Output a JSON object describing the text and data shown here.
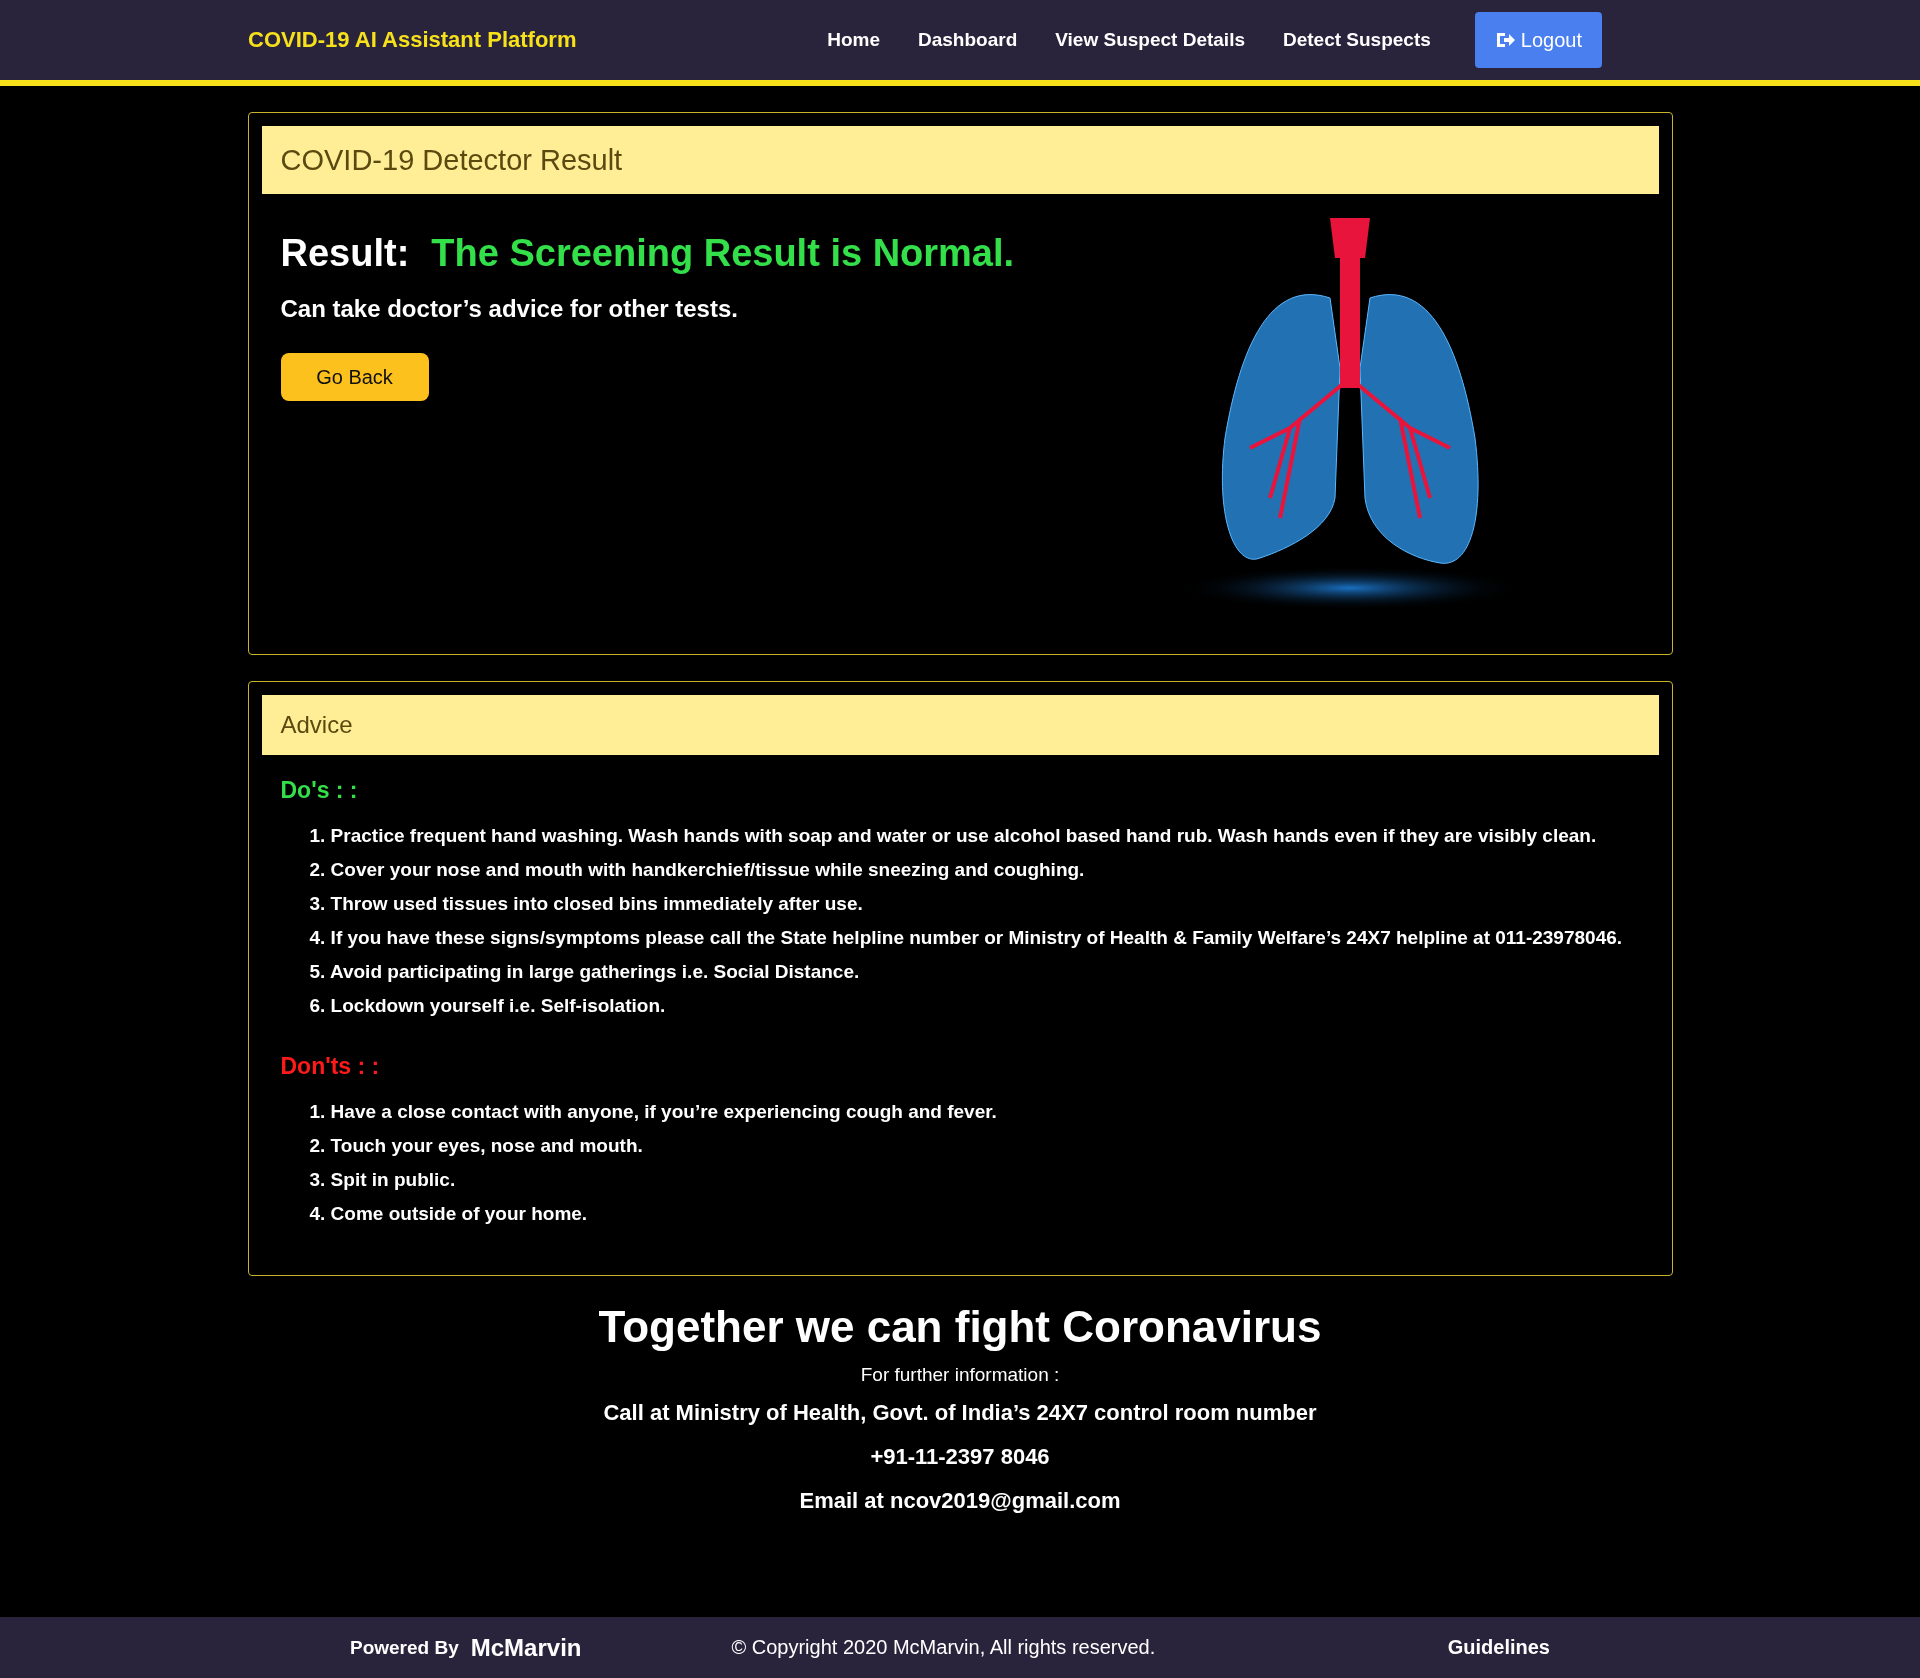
{
  "navbar": {
    "brand": "COVID-19 AI Assistant Platform",
    "links": [
      {
        "label": "Home"
      },
      {
        "label": "Dashboard"
      },
      {
        "label": "View Suspect Details"
      },
      {
        "label": "Detect Suspects"
      }
    ],
    "logout": "Logout"
  },
  "result_card": {
    "title": "COVID-19 Detector Result",
    "result_label": "Result:",
    "result_text": "The Screening Result is Normal.",
    "advice_text": "Can take doctor’s advice for other tests.",
    "button": "Go Back"
  },
  "advice_card": {
    "title": "Advice",
    "sections": [
      {
        "heading": "Do's : :",
        "kind": "do",
        "items": [
          "1. Practice frequent hand washing. Wash hands with soap and water or use alcohol based hand rub. Wash hands even if they are visibly clean.",
          "2. Cover your nose and mouth with handkerchief/tissue while sneezing and coughing.",
          "3. Throw used tissues into closed bins immediately after use.",
          "4. If you have these signs/symptoms please call the State helpline number or Ministry of Health & Family Welfare’s 24X7 helpline at 011-23978046.",
          "5. Avoid participating in large gatherings i.e. Social Distance.",
          "6. Lockdown yourself i.e. Self-isolation."
        ]
      },
      {
        "heading": "Don'ts : :",
        "kind": "dont",
        "items": [
          "1. Have a close contact with anyone, if you’re experiencing cough and fever.",
          "2. Touch your eyes, nose and mouth.",
          "3. Spit in public.",
          "4. Come outside of your home."
        ]
      }
    ]
  },
  "info": {
    "heading": "Together we can fight Coronavirus",
    "subtitle": "For further information :",
    "lines": [
      "Call at Ministry of Health, Govt. of India’s 24X7 control room number",
      "+91-11-2397 8046",
      "Email at ncov2019@gmail.com"
    ]
  },
  "footer": {
    "powered_by": "Powered By",
    "brand": "McMarvin",
    "copyright": "© Copyright 2020 McMarvin, All rights reserved.",
    "link": "Guidelines"
  }
}
